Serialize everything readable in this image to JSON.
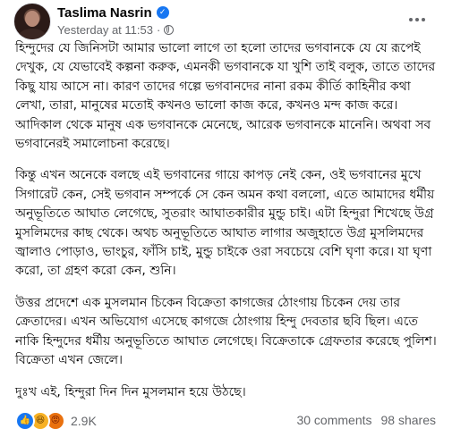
{
  "post": {
    "author": "Taslima Nasrin",
    "verified_icon": "verified-badge-icon",
    "timestamp": "Yesterday at 11:53",
    "separator": "·",
    "audience_icon": "globe-icon",
    "paragraphs": [
      "হিন্দুদের যে জিনিসটা আমার ভালো লাগে তা হলো তাদের ভগবানকে যে যে রূপেই দেখুক, যে যেভাবেই কল্পনা করুক, এমনকী ভগবানকে যা খুশি তাই বলুক, তাতে তাদের কিছু যায় আসে না। কারণ তাদের গল্পে ভগবানদের নানা রকম কীর্তি কাহিনীর কথা লেখা, তারা, মানুষের মতোই কখনও ভালো কাজ করে, কখনও মন্দ কাজ করে। আদিকাল থেকে মানুষ এক ভগবানকে মেনেছে, আরেক ভগবানকে মানেনি। অথবা সব ভগবানেরই সমালোচনা করেছে।",
      "কিন্তু এখন অনেকে বলছে এই ভগবানের গায়ে কাপড় নেই কেন, ওই ভগবানের মুখে সিগারেট কেন, সেই ভগবান সম্পর্কে সে কেন অমন কথা বললো, এতে আমাদের ধর্মীয় অনুভূতিতে আঘাত লেগেছে, সুতরাং আঘাতকারীর মুন্ডু চাই। এটা হিন্দুরা শিখেছে উগ্র মুসলিমদের কাছ থেকে। অথচ অনুভূতিতে আঘাত লাগার অজুহাতে উগ্র মুসলিমদের জ্বালাও পোড়াও, ভাংচুর, ফাঁসি চাই, মুন্ডু চাইকে ওরা সবচেয়ে বেশি ঘৃণা করে। যা ঘৃণা করো, তা গ্রহণ করো কেন, শুনি।",
      "উত্তর প্রদেশে এক মুসলমান চিকেন বিক্রেতা কাগজের ঠোংগায় চিকেন দেয় তার ক্রেতাদের। এখন অভিযোগ এসেছে কাগজে ঠোংগায় হিন্দু দেবতার ছবি ছিল। এতে নাকি হিন্দুদের ধর্মীয় অনুভূতিতে আঘাত লেগেছে। বিক্রেতাকে গ্রেফতার করেছে পুলিশ। বিক্রেতা এখন জেলে।",
      "দুঃখ এই, হিন্দুরা দিন দিন মুসলমান হয়ে উঠছে।"
    ]
  },
  "reactions": {
    "icons": [
      "like-icon",
      "haha-icon",
      "angry-icon"
    ],
    "count": "2.9K"
  },
  "engagement": {
    "comments": "30 comments",
    "shares": "98 shares"
  },
  "colors": {
    "accent": "#1877f2",
    "secondary_text": "#65676b",
    "primary_text": "#050505"
  }
}
